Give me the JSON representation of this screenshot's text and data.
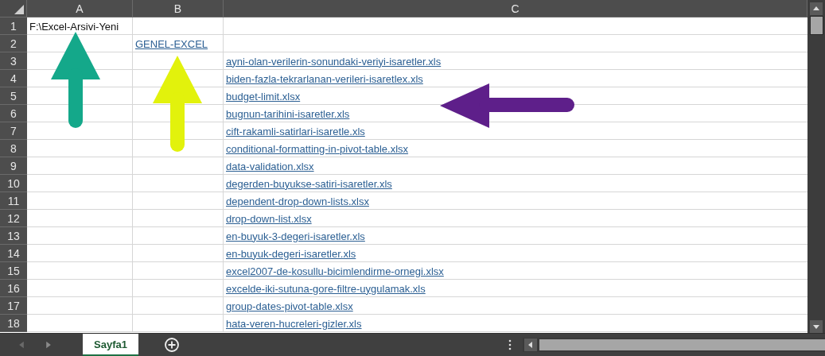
{
  "columns": [
    {
      "label": "A"
    },
    {
      "label": "B"
    },
    {
      "label": "C"
    }
  ],
  "rows": [
    {
      "number": "1",
      "a": {
        "text": "F:\\Excel-Arsivi-Yeni",
        "kind": "text"
      }
    },
    {
      "number": "2",
      "b": {
        "text": "GENEL-EXCEL",
        "kind": "link"
      }
    },
    {
      "number": "3",
      "c": {
        "text": "ayni-olan-verilerin-sonundaki-veriyi-isaretler.xls",
        "kind": "link"
      }
    },
    {
      "number": "4",
      "c": {
        "text": "biden-fazla-tekrarlanan-verileri-isaretlex.xls",
        "kind": "link"
      }
    },
    {
      "number": "5",
      "c": {
        "text": "budget-limit.xlsx",
        "kind": "link"
      }
    },
    {
      "number": "6",
      "c": {
        "text": "bugnun-tarihini-isaretler.xls",
        "kind": "link"
      }
    },
    {
      "number": "7",
      "c": {
        "text": "cift-rakamli-satirlari-isaretle.xls",
        "kind": "link"
      }
    },
    {
      "number": "8",
      "c": {
        "text": "conditional-formatting-in-pivot-table.xlsx",
        "kind": "link"
      }
    },
    {
      "number": "9",
      "c": {
        "text": "data-validation.xlsx",
        "kind": "link"
      }
    },
    {
      "number": "10",
      "c": {
        "text": "degerden-buyukse-satiri-isaretler.xls",
        "kind": "link"
      }
    },
    {
      "number": "11",
      "c": {
        "text": "dependent-drop-down-lists.xlsx",
        "kind": "link"
      }
    },
    {
      "number": "12",
      "c": {
        "text": "drop-down-list.xlsx",
        "kind": "link"
      }
    },
    {
      "number": "13",
      "c": {
        "text": "en-buyuk-3-degeri-isaretler.xls",
        "kind": "link"
      }
    },
    {
      "number": "14",
      "c": {
        "text": "en-buyuk-degeri-isaretler.xls",
        "kind": "link"
      }
    },
    {
      "number": "15",
      "c": {
        "text": "excel2007-de-kosullu-bicimlendirme-ornegi.xlsx",
        "kind": "link"
      }
    },
    {
      "number": "16",
      "c": {
        "text": "excelde-iki-sutuna-gore-filtre-uygulamak.xls",
        "kind": "link"
      }
    },
    {
      "number": "17",
      "c": {
        "text": "group-dates-pivot-table.xlsx",
        "kind": "link"
      }
    },
    {
      "number": "18",
      "c": {
        "text": "hata-veren-hucreleri-gizler.xls",
        "kind": "link"
      }
    }
  ],
  "arrows": [
    {
      "kind": "up",
      "color": "#14a88a"
    },
    {
      "kind": "up",
      "color": "#e2f20c"
    },
    {
      "kind": "left",
      "color": "#5e1f8a"
    }
  ],
  "sheet_tabs": [
    {
      "label": "Sayfa1",
      "selected": true
    }
  ]
}
